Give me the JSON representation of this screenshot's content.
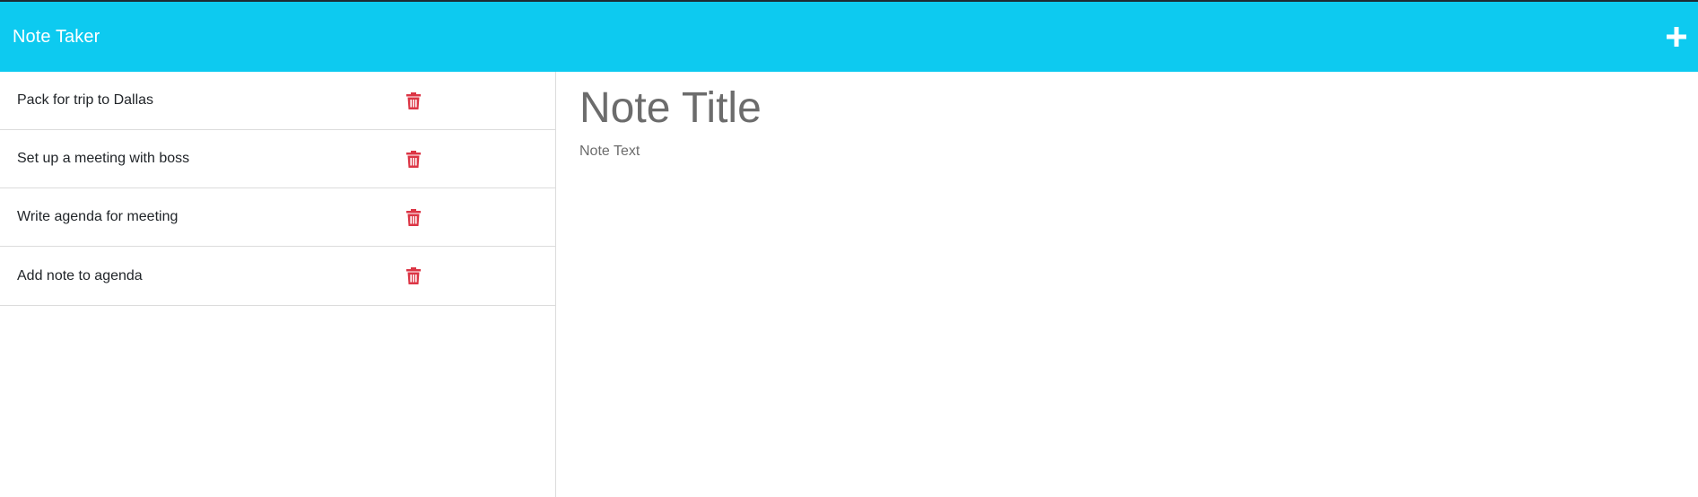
{
  "navbar": {
    "brand": "Note Taker",
    "new_note_icon": "plus-icon"
  },
  "notes": [
    {
      "title": "Pack for trip to Dallas",
      "delete_icon": "trash-icon"
    },
    {
      "title": "Set up a meeting with boss",
      "delete_icon": "trash-icon"
    },
    {
      "title": "Write agenda for meeting",
      "delete_icon": "trash-icon"
    },
    {
      "title": "Add note to agenda",
      "delete_icon": "trash-icon"
    }
  ],
  "editor": {
    "title_placeholder": "Note Title",
    "title_value": "",
    "text_placeholder": "Note Text",
    "text_value": ""
  },
  "colors": {
    "navbar_bg": "#0dcaf0",
    "delete_icon": "#dc3545",
    "placeholder": "#6c6c6c"
  }
}
